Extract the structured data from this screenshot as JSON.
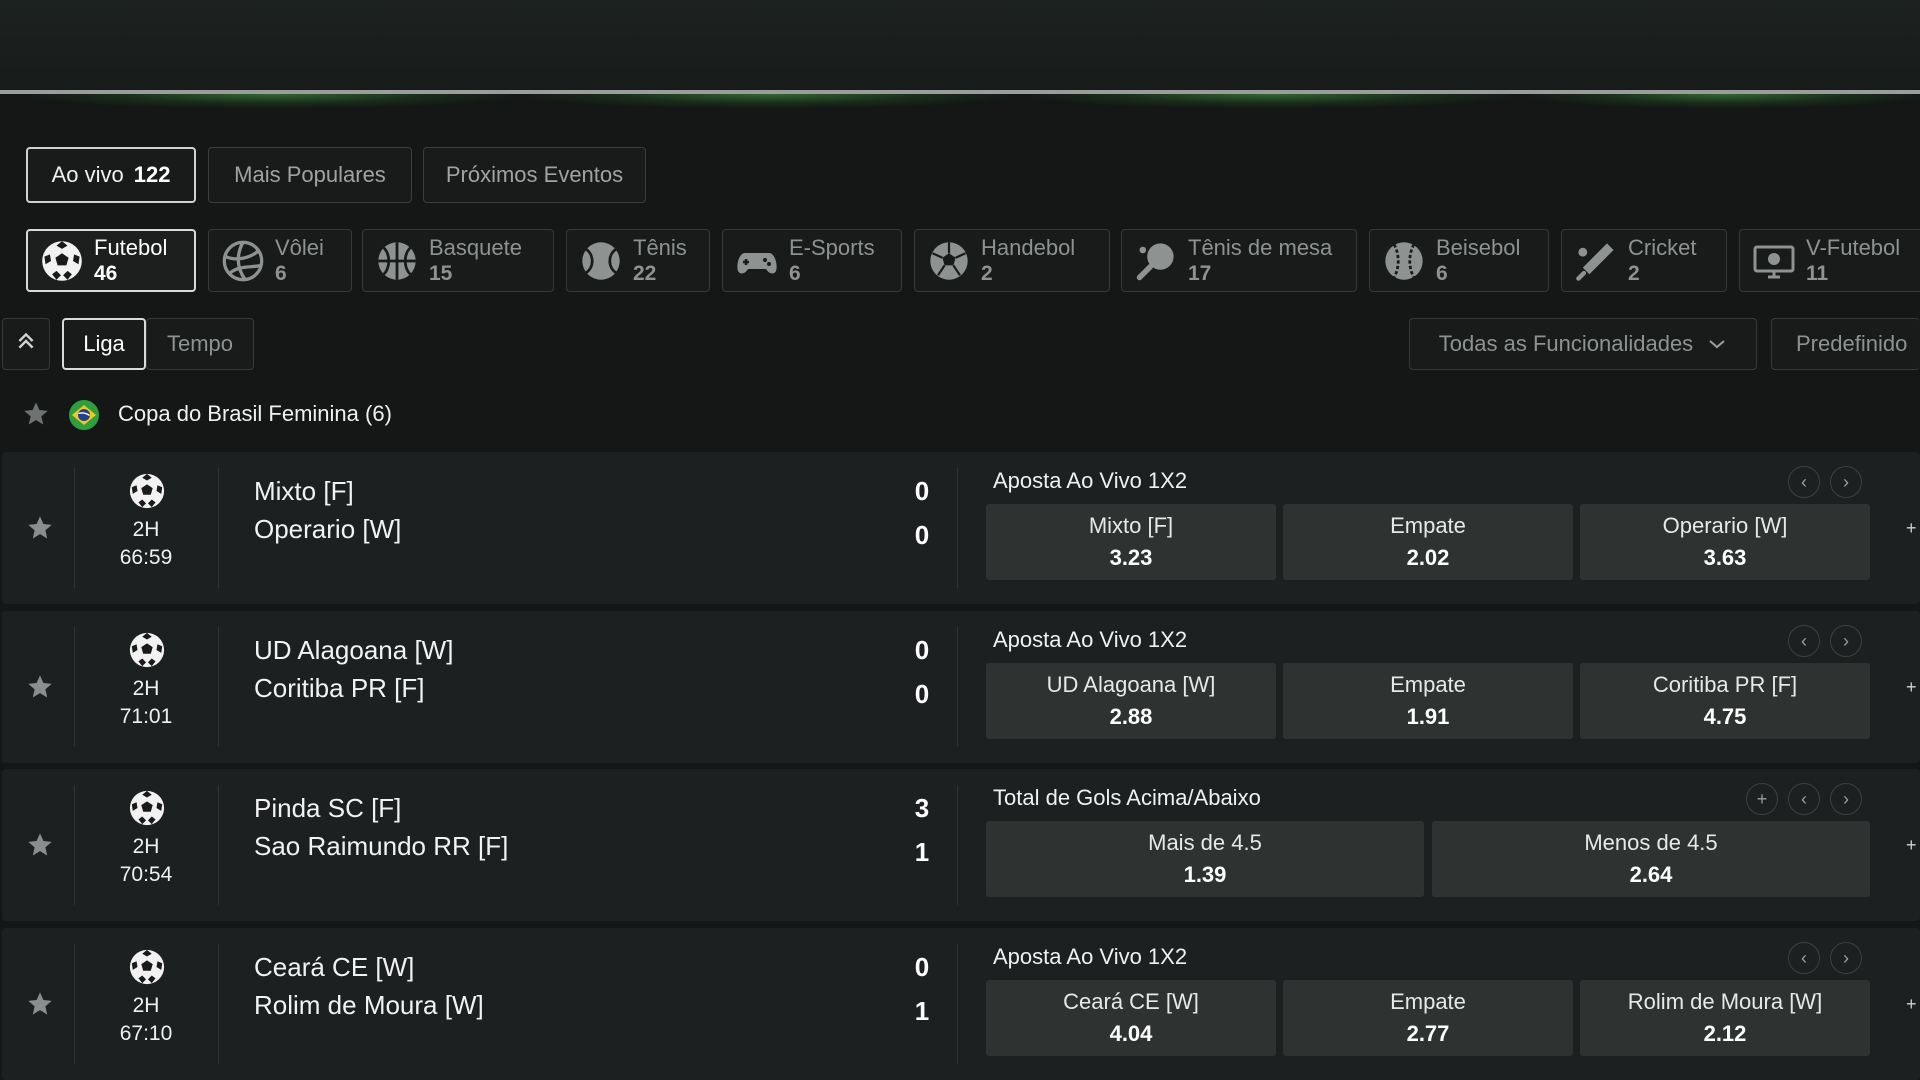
{
  "tabs": [
    {
      "label": "Ao vivo",
      "count": "122"
    },
    {
      "label": "Mais Populares"
    },
    {
      "label": "Próximos Eventos"
    }
  ],
  "sports": [
    {
      "name": "Futebol",
      "count": "46",
      "icon": "soccer-ball-icon"
    },
    {
      "name": "Vôlei",
      "count": "6",
      "icon": "volleyball-icon"
    },
    {
      "name": "Basquete",
      "count": "15",
      "icon": "basketball-icon"
    },
    {
      "name": "Tênis",
      "count": "22",
      "icon": "tennis-ball-icon"
    },
    {
      "name": "E-Sports",
      "count": "6",
      "icon": "gamepad-icon"
    },
    {
      "name": "Handebol",
      "count": "2",
      "icon": "handball-icon"
    },
    {
      "name": "Tênis de mesa",
      "count": "17",
      "icon": "ping-pong-icon"
    },
    {
      "name": "Beisebol",
      "count": "6",
      "icon": "baseball-icon"
    },
    {
      "name": "Cricket",
      "count": "2",
      "icon": "cricket-bat-icon"
    },
    {
      "name": "V-Futebol",
      "count": "11",
      "icon": "virtual-soccer-icon"
    }
  ],
  "view_toggle": {
    "league": "Liga",
    "time": "Tempo"
  },
  "filters": {
    "features": "Todas as Funcionalidades",
    "preset": "Predefinido"
  },
  "league": {
    "name": "Copa do Brasil Feminina (6)"
  },
  "matches": [
    {
      "period": "2H",
      "clock": "66:59",
      "team1": "Mixto [F]",
      "team2": "Operario [W]",
      "score1": "0",
      "score2": "0",
      "market": "Aposta Ao Vivo 1X2",
      "odds": [
        {
          "label": "Mixto [F]",
          "value": "3.23"
        },
        {
          "label": "Empate",
          "value": "2.02"
        },
        {
          "label": "Operario [W]",
          "value": "3.63"
        }
      ]
    },
    {
      "period": "2H",
      "clock": "71:01",
      "team1": "UD Alagoana [W]",
      "team2": "Coritiba PR [F]",
      "score1": "0",
      "score2": "0",
      "market": "Aposta Ao Vivo 1X2",
      "odds": [
        {
          "label": "UD Alagoana [W]",
          "value": "2.88"
        },
        {
          "label": "Empate",
          "value": "1.91"
        },
        {
          "label": "Coritiba PR [F]",
          "value": "4.75"
        }
      ]
    },
    {
      "period": "2H",
      "clock": "70:54",
      "team1": "Pinda SC [F]",
      "team2": "Sao Raimundo RR [F]",
      "score1": "3",
      "score2": "1",
      "market": "Total de Gols Acima/Abaixo",
      "odds": [
        {
          "label": "Mais de  4.5",
          "value": "1.39"
        },
        {
          "label": "Menos de  4.5",
          "value": "2.64"
        }
      ]
    },
    {
      "period": "2H",
      "clock": "67:10",
      "team1": "Ceará CE [W]",
      "team2": "Rolim de Moura [W]",
      "score1": "0",
      "score2": "1",
      "market": "Aposta Ao Vivo 1X2",
      "odds": [
        {
          "label": "Ceará CE [W]",
          "value": "4.04"
        },
        {
          "label": "Empate",
          "value": "2.77"
        },
        {
          "label": "Rolim de Moura [W]",
          "value": "2.12"
        }
      ]
    }
  ],
  "colors": {
    "background": "#141716",
    "card": "#1c2020",
    "odd_button": "#2e3332",
    "banner_glow": "#4aaa46"
  }
}
